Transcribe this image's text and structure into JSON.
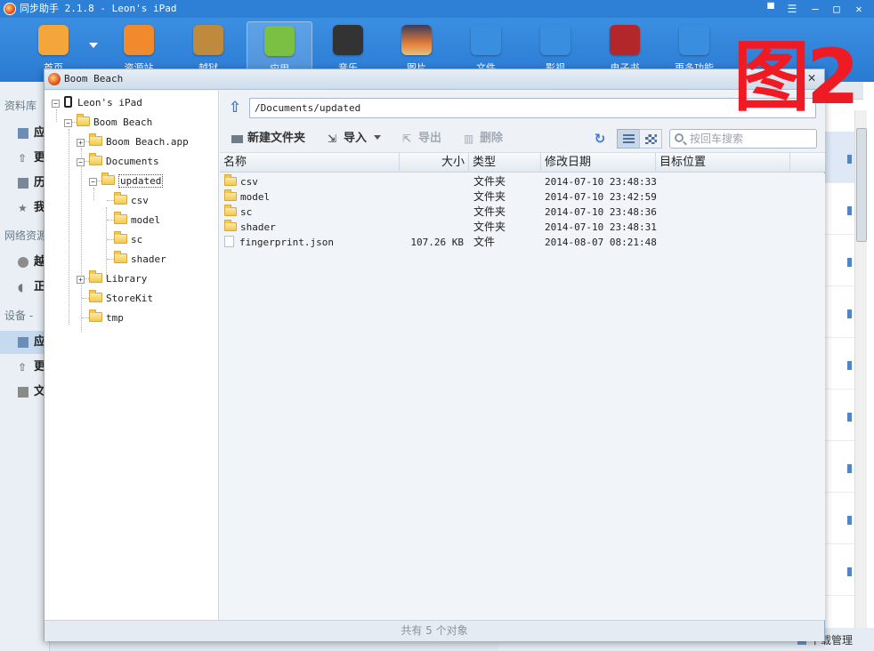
{
  "app": {
    "title": "同步助手 2.1.8 - Leon's iPad",
    "controls": {
      "pin": "▀",
      "min": "—",
      "max": "□",
      "close": "✕"
    }
  },
  "toolbar": {
    "items": [
      {
        "label": "首页",
        "icon": "home-icon",
        "color": "#f4a63b"
      },
      {
        "label": "资源站",
        "icon": "shopping-bag-icon",
        "color": "#f08a2c"
      },
      {
        "label": "越狱",
        "icon": "pineapple-icon",
        "color": "#c08a3e"
      },
      {
        "label": "应用",
        "icon": "apps-icon",
        "color": "#7ac043"
      },
      {
        "label": "音乐",
        "icon": "music-icon",
        "color": "#333333"
      },
      {
        "label": "图片",
        "icon": "photo-icon",
        "color": "#e07b39"
      },
      {
        "label": "文件",
        "icon": "file-sync-icon",
        "color": "#3a8ee0"
      },
      {
        "label": "影视",
        "icon": "video-icon",
        "color": "#3a8ee0"
      },
      {
        "label": "电子书",
        "icon": "ebook-icon",
        "color": "#b3262a"
      },
      {
        "label": "更多功能",
        "icon": "tools-icon",
        "color": "#3a8ee0"
      }
    ]
  },
  "sidebar": {
    "groups": [
      "资料库",
      "网络资源",
      "设备 -"
    ],
    "items": [
      "应",
      "更",
      "历",
      "我",
      "越",
      "正",
      "应",
      "更",
      "文"
    ]
  },
  "footer": {
    "download_manager": "下载管理"
  },
  "watermark": "图2",
  "dialog": {
    "title": "Boom Beach",
    "close": "✕",
    "tree": {
      "device": "Leon's iPad",
      "nodes": [
        "Boom Beach",
        "Boom Beach.app",
        "Documents",
        "updated",
        "csv",
        "model",
        "sc",
        "shader",
        "Library",
        "StoreKit",
        "tmp"
      ]
    },
    "path": "/Documents/updated",
    "actions": {
      "new_folder": "新建文件夹",
      "import": "导入",
      "export": "导出",
      "delete": "删除"
    },
    "search_placeholder": "按回车搜索",
    "columns": {
      "name": "名称",
      "size": "大小",
      "type": "类型",
      "modified": "修改日期",
      "target": "目标位置"
    },
    "rows": [
      {
        "name": "csv",
        "size": "",
        "type": "文件夹",
        "modified": "2014-07-10 23:48:33"
      },
      {
        "name": "model",
        "size": "",
        "type": "文件夹",
        "modified": "2014-07-10 23:42:59"
      },
      {
        "name": "sc",
        "size": "",
        "type": "文件夹",
        "modified": "2014-07-10 23:48:36"
      },
      {
        "name": "shader",
        "size": "",
        "type": "文件夹",
        "modified": "2014-07-10 23:48:31"
      },
      {
        "name": "fingerprint.json",
        "size": "107.26 KB",
        "type": "文件",
        "modified": "2014-08-07 08:21:48"
      }
    ],
    "status": "共有 5 个对象"
  }
}
